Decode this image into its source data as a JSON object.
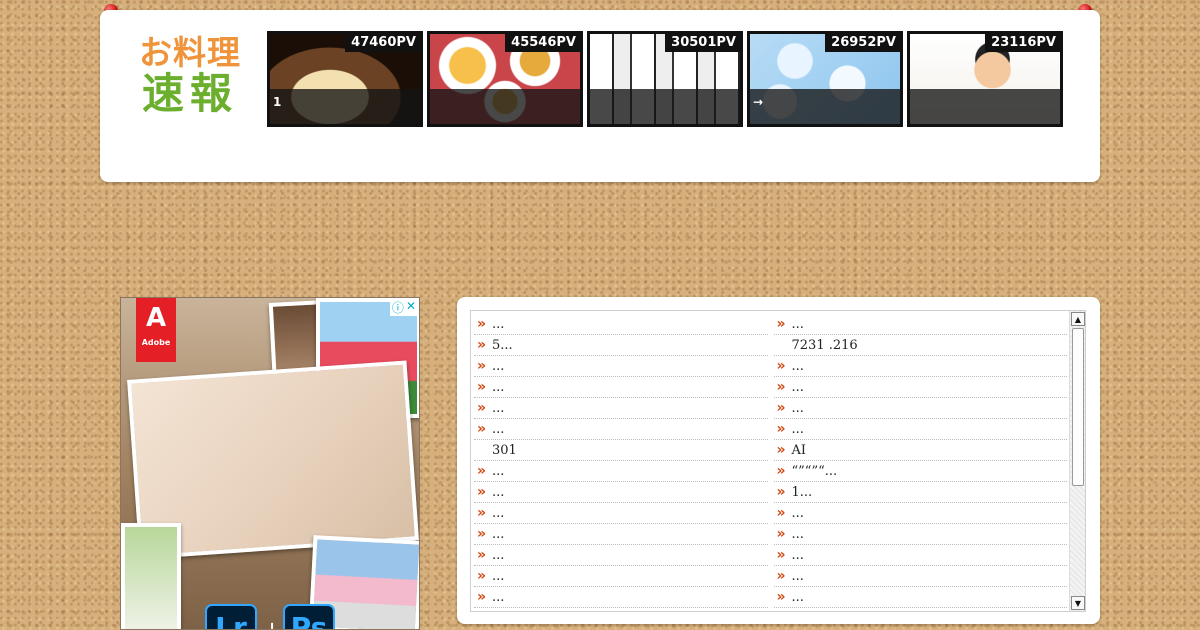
{
  "header": {
    "logo_top": "お料理",
    "logo_bottom": "速報",
    "thumbs": [
      {
        "pv": "47460PV",
        "caption": "1"
      },
      {
        "pv": "45546PV",
        "caption": ""
      },
      {
        "pv": "30501PV",
        "caption": ""
      },
      {
        "pv": "26952PV",
        "caption": "→"
      },
      {
        "pv": "23116PV",
        "caption": ""
      }
    ]
  },
  "ad": {
    "adobe_symbol": "A",
    "adobe_text": "Adobe",
    "info_icon": "ⓘ",
    "close_icon": "✕",
    "lr": "Lr",
    "plus": "+",
    "ps": "Ps"
  },
  "list": {
    "left": [
      {
        "text": "...",
        "chev": true
      },
      {
        "text": "5...",
        "chev": true
      },
      {
        "text": "...",
        "chev": true
      },
      {
        "text": "...",
        "chev": true
      },
      {
        "text": "...",
        "chev": true
      },
      {
        "text": "...",
        "chev": true
      },
      {
        "text": "301",
        "chev": false
      },
      {
        "text": "...",
        "chev": true
      },
      {
        "text": "...",
        "chev": true
      },
      {
        "text": "...",
        "chev": true
      },
      {
        "text": "...",
        "chev": true
      },
      {
        "text": "...",
        "chev": true
      },
      {
        "text": " ...",
        "chev": true
      },
      {
        "text": "...",
        "chev": true
      }
    ],
    "right": [
      {
        "text": "...",
        "chev": true
      },
      {
        "text": "7231 .216",
        "chev": false
      },
      {
        "text": "...",
        "chev": true
      },
      {
        "text": "...",
        "chev": true
      },
      {
        "text": "...",
        "chev": true
      },
      {
        "text": "...",
        "chev": true
      },
      {
        "text": "AI",
        "chev": true
      },
      {
        "text": "“”“”“...",
        "chev": true
      },
      {
        "text": "1...",
        "chev": true
      },
      {
        "text": "...",
        "chev": true
      },
      {
        "text": "...",
        "chev": true
      },
      {
        "text": "...",
        "chev": true
      },
      {
        "text": "...",
        "chev": true
      },
      {
        "text": "...",
        "chev": true
      }
    ],
    "chev_glyph": "»",
    "scroll_up": "▲",
    "scroll_down": "▼"
  }
}
